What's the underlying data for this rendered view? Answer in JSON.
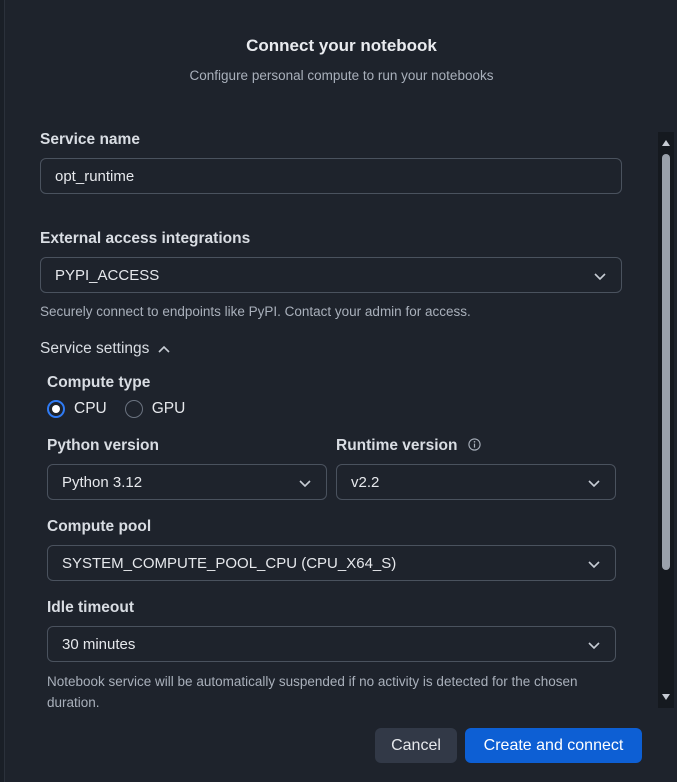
{
  "dialog": {
    "title": "Connect your notebook",
    "subtitle": "Configure personal compute to run your notebooks"
  },
  "service_name": {
    "label": "Service name",
    "value": "opt_runtime"
  },
  "external_access": {
    "label": "External access integrations",
    "value": "PYPI_ACCESS",
    "help": "Securely connect to endpoints like PyPI. Contact your admin for access."
  },
  "service_settings": {
    "label": "Service settings",
    "expanded": true,
    "compute_type": {
      "label": "Compute type",
      "options": [
        "CPU",
        "GPU"
      ],
      "selected": "CPU"
    },
    "python_version": {
      "label": "Python version",
      "value": "Python 3.12"
    },
    "runtime_version": {
      "label": "Runtime version",
      "value": "v2.2"
    },
    "compute_pool": {
      "label": "Compute pool",
      "value": "SYSTEM_COMPUTE_POOL_CPU (CPU_X64_S)"
    },
    "idle_timeout": {
      "label": "Idle timeout",
      "value": "30 minutes",
      "help": "Notebook service will be automatically suspended if no activity is detected for the chosen duration."
    }
  },
  "footer": {
    "cancel_label": "Cancel",
    "submit_label": "Create and connect"
  },
  "colors": {
    "background": "#1e232c",
    "primary": "#0d5fd4",
    "radio_accent": "#2f7bf5",
    "border": "#4a525e"
  },
  "icons": {
    "select_chevron": "chevron-down-icon",
    "section_toggle": "chevron-up-icon",
    "runtime_info": "info-icon"
  }
}
